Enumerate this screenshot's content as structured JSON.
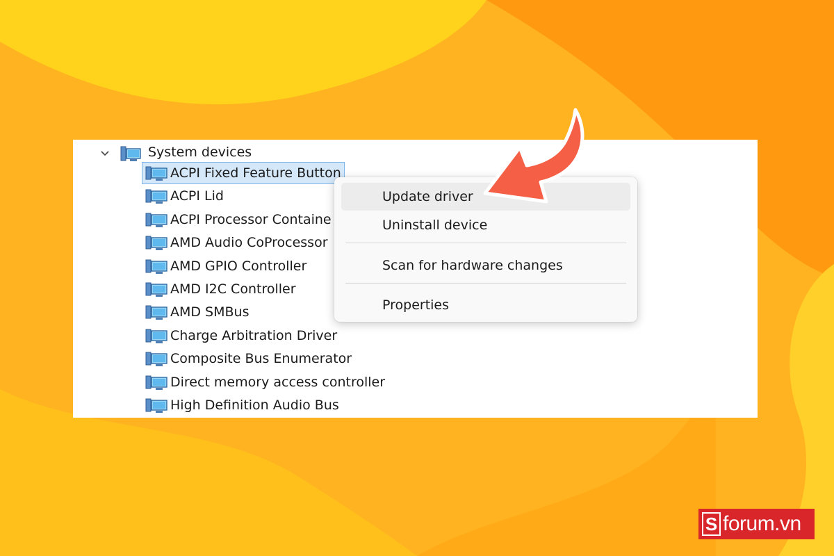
{
  "tree": {
    "root_label": "System devices",
    "root_icon": "device-manager-icon",
    "expand_icon": "chevron-down-icon",
    "items": [
      {
        "label": "ACPI Fixed Feature Button",
        "selected": true
      },
      {
        "label": "ACPI Lid"
      },
      {
        "label": "ACPI Processor Containe"
      },
      {
        "label": "AMD Audio CoProcessor"
      },
      {
        "label": "AMD GPIO Controller"
      },
      {
        "label": "AMD I2C Controller"
      },
      {
        "label": "AMD SMBus"
      },
      {
        "label": "Charge Arbitration Driver"
      },
      {
        "label": "Composite Bus Enumerator"
      },
      {
        "label": "Direct memory access controller"
      },
      {
        "label": "High Definition Audio Bus"
      }
    ]
  },
  "context_menu": {
    "items": [
      {
        "label": "Update driver",
        "highlighted": true
      },
      {
        "label": "Uninstall device"
      },
      {
        "label": "Scan for hardware changes"
      },
      {
        "label": "Properties"
      }
    ]
  },
  "annotation": {
    "icon": "curved-arrow-icon",
    "color": "#f45f45"
  },
  "watermark": {
    "mark": "S",
    "text": "forum.vn",
    "color": "#d8262a"
  },
  "colors": {
    "background_light": "#ffd21c",
    "background_dark": "#ff9a10",
    "selection": "#d5e8fa",
    "menu_hover": "#ececec"
  }
}
